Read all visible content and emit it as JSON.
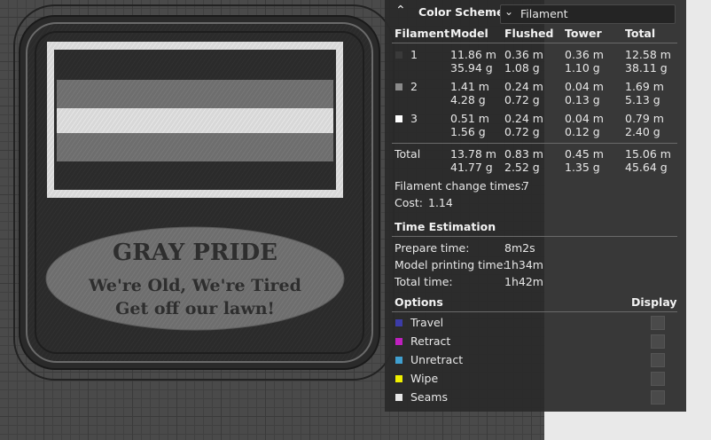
{
  "model": {
    "title_text": "GRAY PRIDE",
    "line1": "We're Old, We're Tired",
    "line2": "Get off our lawn!"
  },
  "panel": {
    "color_scheme_label": "Color Scheme",
    "color_scheme_value": "Filament",
    "headers": [
      "Filament",
      "Model",
      "Flushed",
      "Tower",
      "Total"
    ],
    "filaments": [
      {
        "id": "1",
        "color": "#3a3a3a",
        "model_m": "11.86 m",
        "model_g": "35.94 g",
        "flushed_m": "0.36 m",
        "flushed_g": "1.08 g",
        "tower_m": "0.36 m",
        "tower_g": "1.10 g",
        "total_m": "12.58 m",
        "total_g": "38.11 g"
      },
      {
        "id": "2",
        "color": "#8a8a8a",
        "model_m": "1.41 m",
        "model_g": "4.28 g",
        "flushed_m": "0.24 m",
        "flushed_g": "0.72 g",
        "tower_m": "0.04 m",
        "tower_g": "0.13 g",
        "total_m": "1.69 m",
        "total_g": "5.13 g"
      },
      {
        "id": "3",
        "color": "#ffffff",
        "model_m": "0.51 m",
        "model_g": "1.56 g",
        "flushed_m": "0.24 m",
        "flushed_g": "0.72 g",
        "tower_m": "0.04 m",
        "tower_g": "0.12 g",
        "total_m": "0.79 m",
        "total_g": "2.40 g"
      }
    ],
    "total": {
      "label": "Total",
      "model_m": "13.78 m",
      "model_g": "41.77 g",
      "flushed_m": "0.83 m",
      "flushed_g": "2.52 g",
      "tower_m": "0.45 m",
      "tower_g": "1.35 g",
      "total_m": "15.06 m",
      "total_g": "45.64 g"
    },
    "filament_change_label": "Filament change times:",
    "filament_change_value": "7",
    "cost_label": "Cost:",
    "cost_value": "1.14",
    "time_estimation_label": "Time Estimation",
    "prepare_label": "Prepare time:",
    "prepare_value": "8m2s",
    "model_time_label": "Model printing time:",
    "model_time_value": "1h34m",
    "total_time_label": "Total time:",
    "total_time_value": "1h42m",
    "options_label": "Options",
    "display_label": "Display",
    "options": [
      {
        "label": "Travel",
        "color": "#3c3ca8"
      },
      {
        "label": "Retract",
        "color": "#c020c0"
      },
      {
        "label": "Unretract",
        "color": "#40a0d0"
      },
      {
        "label": "Wipe",
        "color": "#f0f000"
      },
      {
        "label": "Seams",
        "color": "#e8e8e8"
      }
    ]
  }
}
